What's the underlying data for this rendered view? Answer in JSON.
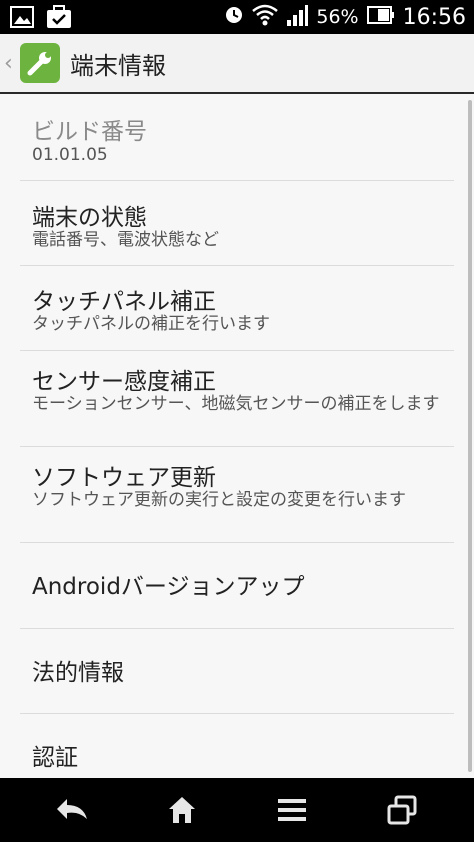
{
  "status_bar": {
    "battery_percent": "56%",
    "time": "16:56",
    "icons": [
      "image-icon",
      "briefcase-check-icon",
      "alarm-icon",
      "wifi-icon",
      "signal-icon",
      "battery-icon"
    ]
  },
  "action_bar": {
    "title": "端末情報",
    "icon": "wrench-icon"
  },
  "list": {
    "items": [
      {
        "title": "ビルド番号",
        "summary": "01.01.05",
        "enabled": false
      },
      {
        "title": "端末の状態",
        "summary": "電話番号、電波状態など",
        "enabled": true
      },
      {
        "title": "タッチパネル補正",
        "summary": "タッチパネルの補正を行います",
        "enabled": true
      },
      {
        "title": "センサー感度補正",
        "summary": "モーションセンサー、地磁気センサーの補正をします",
        "enabled": true
      },
      {
        "title": "ソフトウェア更新",
        "summary": "ソフトウェア更新の実行と設定の変更を行います",
        "enabled": true
      },
      {
        "title": "Androidバージョンアップ",
        "summary": "",
        "enabled": true
      },
      {
        "title": "法的情報",
        "summary": "",
        "enabled": true
      },
      {
        "title": "認証",
        "summary": "",
        "enabled": true
      }
    ]
  },
  "nav_bar": {
    "buttons": [
      "back-icon",
      "home-icon",
      "menu-icon",
      "recent-apps-icon"
    ]
  },
  "colors": {
    "status_bar_bg": "#000000",
    "action_bar_bg": "#f2f2f2",
    "list_bg": "#f7f7f7",
    "app_icon_green": "#6db33f",
    "nav_bar_bg": "#000000"
  }
}
